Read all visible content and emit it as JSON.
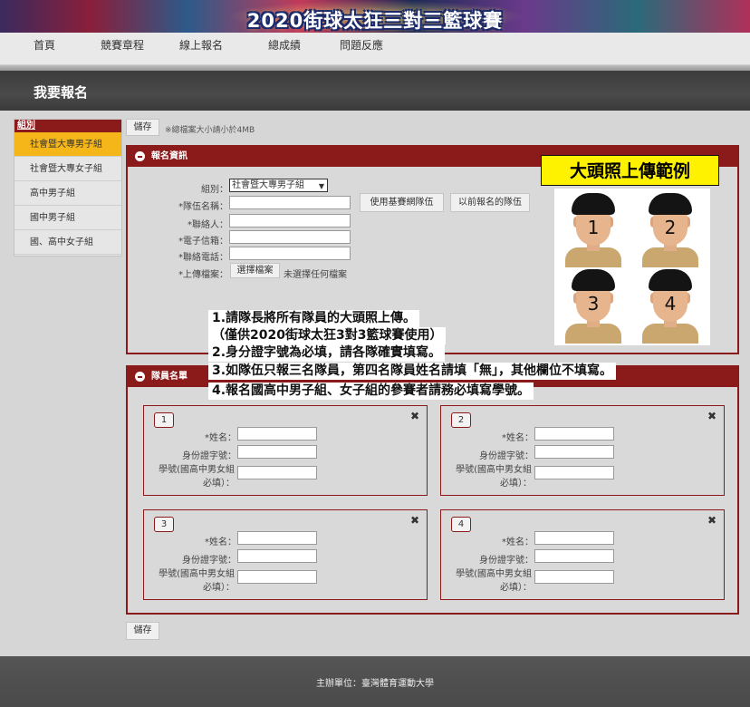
{
  "banner": {
    "title": "2020街球太狂三對三籃球賽"
  },
  "nav": {
    "items": [
      "首頁",
      "競賽章程",
      "線上報名",
      "總成績",
      "問題反應"
    ]
  },
  "page_title": "我要報名",
  "sidebar": {
    "heading": "組別",
    "items": [
      "社會暨大專男子組",
      "社會暨大專女子組",
      "高中男子組",
      "國中男子組",
      "國、高中女子組"
    ],
    "active_index": 0
  },
  "toolbar": {
    "save_label": "儲存",
    "size_note": "※總檔案大小請小於4MB"
  },
  "registration": {
    "heading": "報名資訊",
    "group_label": "組別：",
    "group_value": "社會暨大專男子組",
    "team_label": "*隊伍名稱：",
    "use_team_button": "使用基賽網隊伍",
    "prev_team_button": "以前報名的隊伍",
    "contact_label": "*聯絡人：",
    "email_label": "*電子信箱：",
    "phone_label": "*聯絡電話：",
    "upload_label": "*上傳檔案：",
    "choose_file_button": "選擇檔案",
    "no_file_text": "未選擇任何檔案"
  },
  "sample": {
    "title": "大頭照上傳範例",
    "numbers": [
      "1",
      "2",
      "3",
      "4"
    ]
  },
  "notes": [
    "1.請隊長將所有隊員的大頭照上傳。",
    "（僅供2020街球太狂3對3籃球賽使用）",
    "2.身分證字號為必填，請各隊確實填寫。",
    "3.如隊伍只報三名隊員，第四名隊員姓名請填「無」，其他欄位不填寫。",
    "4.報名國高中男子組、女子組的參賽者請務必填寫學號。"
  ],
  "members": {
    "heading": "隊員名單",
    "name_label": "*姓名：",
    "id_label": "身份證字號：",
    "student_label_1": "學號(國高中男女組",
    "student_label_2": "必填）：",
    "close_icon": "✖",
    "cards": [
      "1",
      "2",
      "3",
      "4"
    ]
  },
  "footer": {
    "text": "主辦單位：臺灣體育運動大學"
  },
  "colors": {
    "accent": "#8b1a1a",
    "active": "#f5b619",
    "highlight": "#fff200"
  }
}
